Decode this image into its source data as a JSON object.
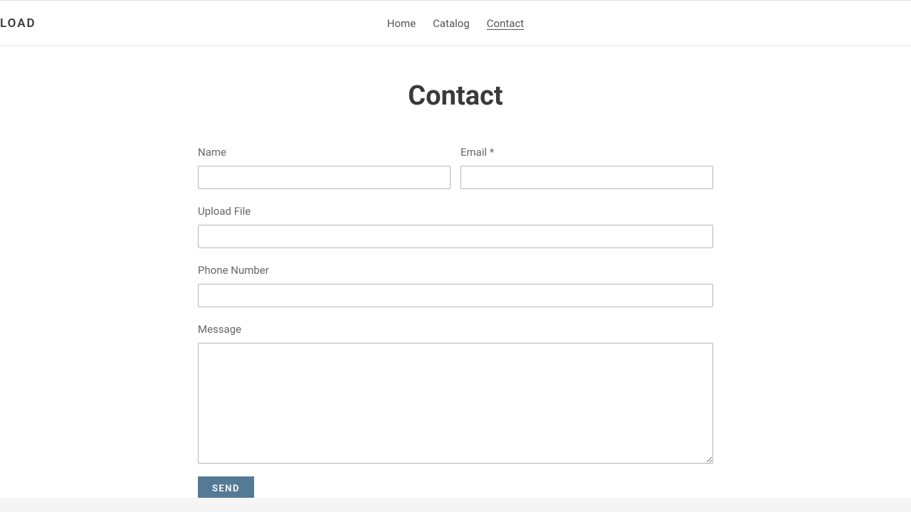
{
  "header": {
    "logo": "LOAD",
    "nav": {
      "home": "Home",
      "catalog": "Catalog",
      "contact": "Contact"
    }
  },
  "page": {
    "title": "Contact"
  },
  "form": {
    "name_label": "Name",
    "email_label": "Email *",
    "upload_label": "Upload File",
    "phone_label": "Phone Number",
    "message_label": "Message",
    "send_label": "SEND"
  }
}
